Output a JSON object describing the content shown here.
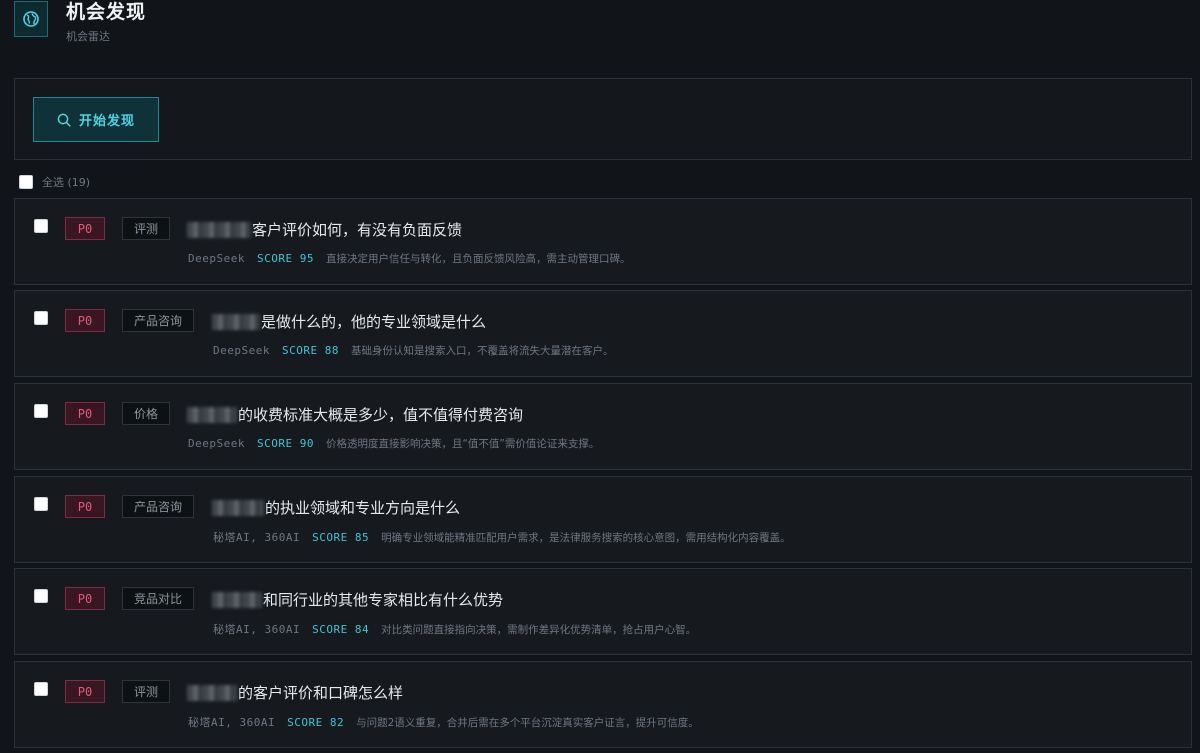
{
  "header": {
    "title": "机会发现",
    "subtitle": "机会雷达"
  },
  "toolbar": {
    "discover_label": "开始发现"
  },
  "select_all": {
    "label": "全选 (19)"
  },
  "items": [
    {
      "priority": "P0",
      "category": "评测",
      "question": "客户评价如何，有没有负面反馈",
      "platforms": "DeepSeek",
      "score": "SCORE 95",
      "reason": "直接决定用户信任与转化，且负面反馈风险高，需主动管理口碑。"
    },
    {
      "priority": "P0",
      "category": "产品咨询",
      "question": "是做什么的，他的专业领域是什么",
      "platforms": "DeepSeek",
      "score": "SCORE 88",
      "reason": "基础身份认知是搜索入口，不覆盖将流失大量潜在客户。"
    },
    {
      "priority": "P0",
      "category": "价格",
      "question": "的收费标准大概是多少，值不值得付费咨询",
      "platforms": "DeepSeek",
      "score": "SCORE 90",
      "reason": "价格透明度直接影响决策，且“值不值”需价值论证来支撑。"
    },
    {
      "priority": "P0",
      "category": "产品咨询",
      "question": "的执业领域和专业方向是什么",
      "platforms": "秘塔AI, 360AI",
      "score": "SCORE 85",
      "reason": "明确专业领域能精准匹配用户需求，是法律服务搜索的核心意图，需用结构化内容覆盖。"
    },
    {
      "priority": "P0",
      "category": "竞品对比",
      "question": "和同行业的其他专家相比有什么优势",
      "platforms": "秘塔AI, 360AI",
      "score": "SCORE 84",
      "reason": "对比类问题直接指向决策，需制作差异化优势清单，抢占用户心智。"
    },
    {
      "priority": "P0",
      "category": "评测",
      "question": "的客户评价和口碑怎么样",
      "platforms": "秘塔AI, 360AI",
      "score": "SCORE 82",
      "reason": "与问题2语义重复，合并后需在多个平台沉淀真实客户证言，提升可信度。"
    }
  ]
}
